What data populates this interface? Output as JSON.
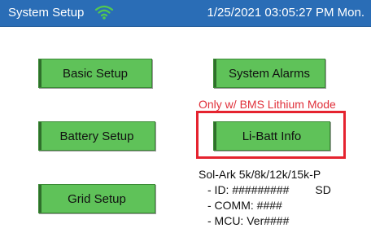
{
  "header": {
    "title": "System Setup",
    "datetime": "1/25/2021 03:05:27 PM  Mon.",
    "wifi_icon": "wifi-icon",
    "bg_color": "#2a6db6"
  },
  "buttons": {
    "basic_setup": "Basic Setup",
    "battery_setup": "Battery Setup",
    "grid_setup": "Grid Setup",
    "system_alarms": "System Alarms",
    "li_batt_info": "Li-Batt Info",
    "color": "#5fc259"
  },
  "annotation": {
    "note": "Only w/ BMS Lithium Mode",
    "color": "#e5232f"
  },
  "device_info": {
    "model": "Sol-Ark 5k/8k/12k/15k-P",
    "id": "- ID: #########",
    "sd": "SD",
    "comm": "- COMM: ####",
    "mcu": "- MCU: Ver####"
  }
}
